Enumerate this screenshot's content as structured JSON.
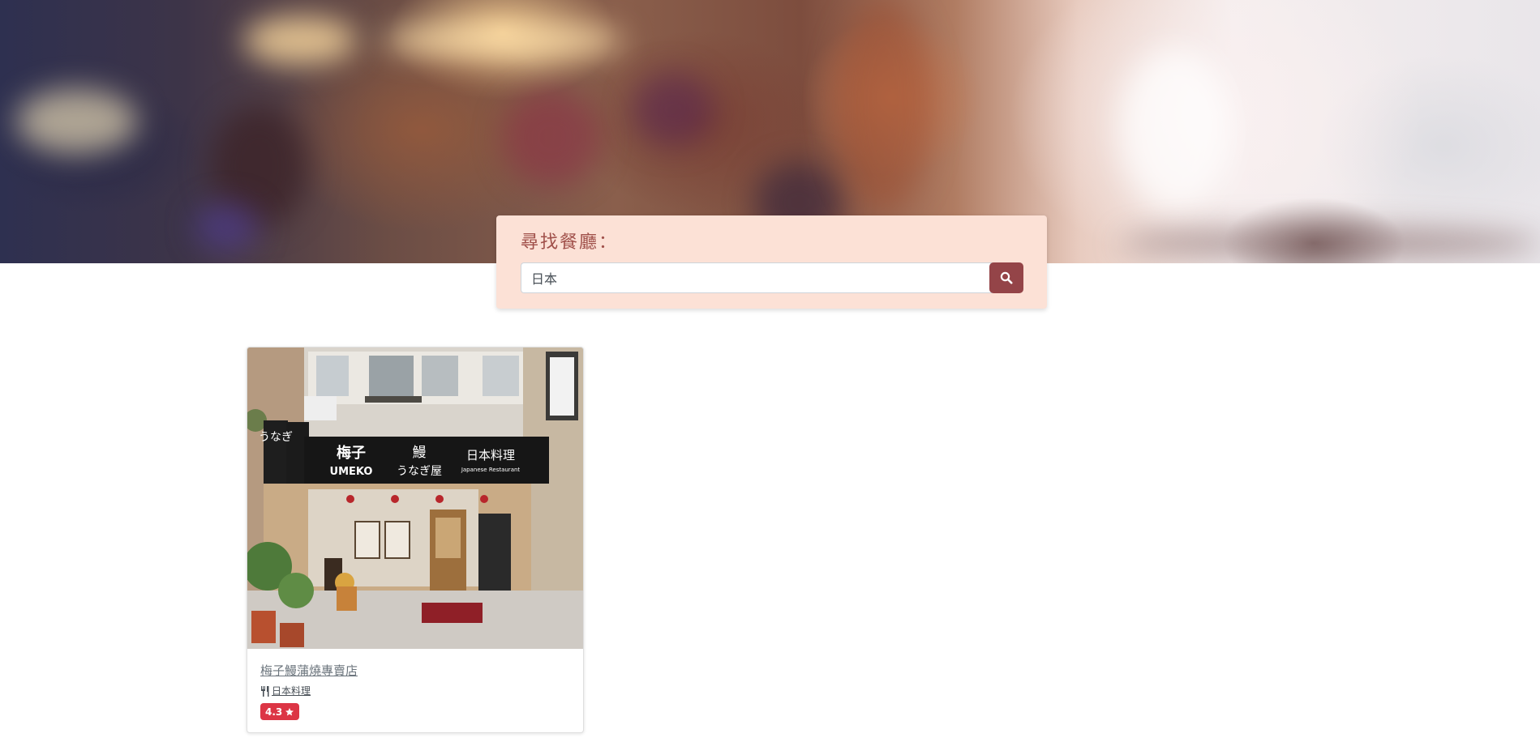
{
  "search": {
    "label": "尋找餐廳：",
    "value": "日本"
  },
  "restaurants": [
    {
      "name": "梅子鰻蒲燒專賣店",
      "category": "日本料理",
      "rating": "4.3",
      "sign": {
        "left_name_cn": "梅子",
        "left_name_en": "UMEKO",
        "middle_top": "鰻",
        "middle_bottom": "うなぎ屋",
        "right_top": "日本料理",
        "right_bottom": "Japanese Restaurant",
        "side_banner": "うなぎ"
      }
    }
  ],
  "colors": {
    "panel_bg": "#fce1d6",
    "label_text": "#a0504a",
    "search_button": "#944448",
    "rating_badge": "#dc3545"
  },
  "icons": {
    "search_button": "search-icon",
    "category": "utensils-icon",
    "rating": "star-icon"
  }
}
